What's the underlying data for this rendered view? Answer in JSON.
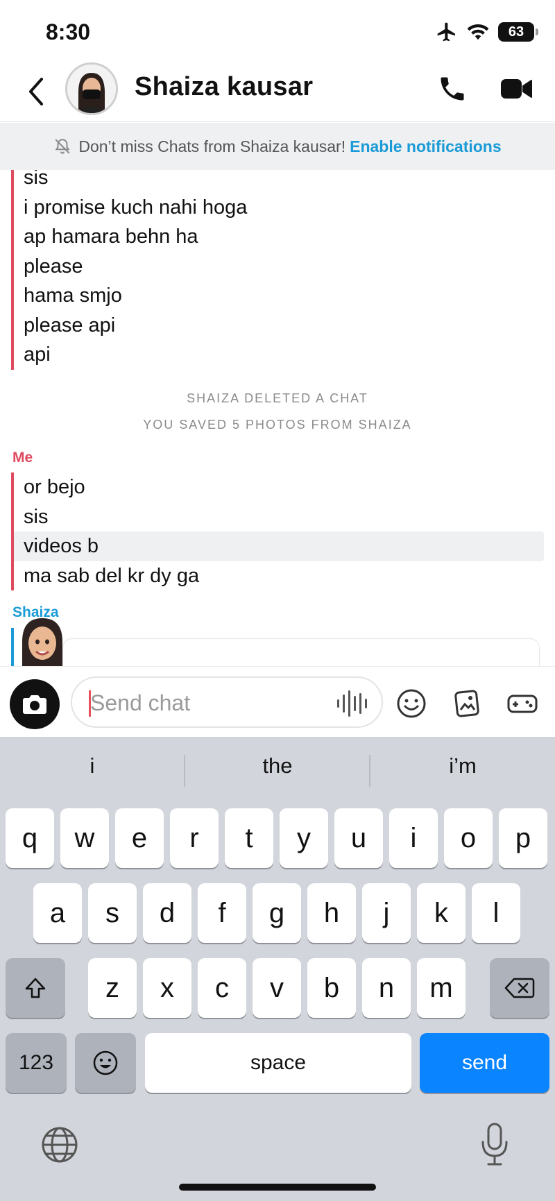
{
  "status": {
    "time": "8:30",
    "battery": "63"
  },
  "header": {
    "title": "Shaiza kausar"
  },
  "banner": {
    "text": "Don’t miss Chats from Shaiza kausar!",
    "link": "Enable notifications"
  },
  "chat": {
    "group1": {
      "messages": [
        "sis",
        "i promise kuch nahi hoga",
        "ap hamara behn ha",
        "please",
        "hama smjo",
        "please api",
        "api"
      ]
    },
    "notes": [
      "SHAIZA DELETED A CHAT",
      "YOU SAVED 5 PHOTOS FROM SHAIZA"
    ],
    "group2": {
      "sender": "Me",
      "messages": [
        "or bejo",
        "sis",
        "videos b",
        "ma sab del kr dy ga"
      ],
      "highlighted_index": 2
    },
    "group3": {
      "sender": "Shaiza"
    }
  },
  "input": {
    "placeholder": "Send chat"
  },
  "keyboard": {
    "suggestions": [
      "i",
      "the",
      "i’m"
    ],
    "row1": [
      "q",
      "w",
      "e",
      "r",
      "t",
      "y",
      "u",
      "i",
      "o",
      "p"
    ],
    "row2": [
      "a",
      "s",
      "d",
      "f",
      "g",
      "h",
      "j",
      "k",
      "l"
    ],
    "row3": [
      "z",
      "x",
      "c",
      "v",
      "b",
      "n",
      "m"
    ],
    "numbers": "123",
    "space": "space",
    "send": "send"
  },
  "colors": {
    "me": "#e04a5f",
    "friend": "#1a9bd7",
    "send_key": "#0a84ff"
  }
}
